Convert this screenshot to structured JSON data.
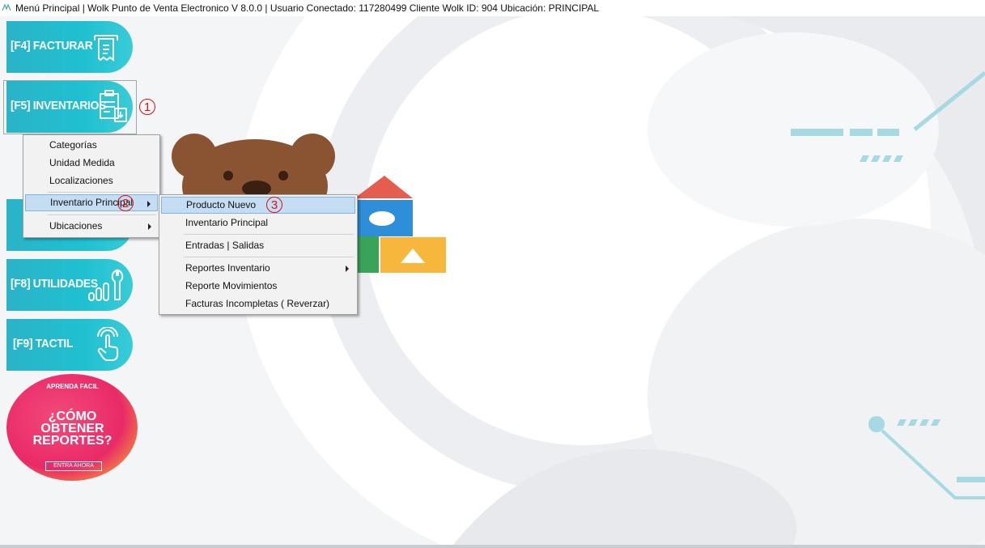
{
  "window": {
    "title": "Menú Principal | Wolk Punto de Venta Electronico V 8.0.0 |  Usuario Conectado: 117280499 Cliente Wolk ID: 904 Ubicación: PRINCIPAL"
  },
  "nav": {
    "facturar": "[F4] FACTURAR",
    "inventarios": "[F5] INVENTARIOS",
    "utilidades": "[F8] UTILIDADES",
    "tactil": "[F9] TACTIL"
  },
  "inventory_menu": {
    "items": [
      "Categorías",
      "Unidad Medida",
      "Localizaciones",
      "Inventario Principal",
      "Ubicaciones"
    ]
  },
  "submenu": {
    "items": [
      "Producto Nuevo",
      "Inventario Principal",
      "Entradas | Salidas",
      "Reportes Inventario",
      "Reporte Movimientos",
      "Facturas Incompletas ( Reverzar)"
    ]
  },
  "annotations": {
    "step1": "1",
    "step2": "2",
    "step3": "3"
  },
  "promo": {
    "kicker": "APRENDA FACIL",
    "line1": "¿CÓMO",
    "line2": "OBTENER",
    "line3": "REPORTES?",
    "cta": "ENTRA AHORA"
  },
  "colors": {
    "accent": "#1fc0d0",
    "highlight": "#c5ddf3",
    "annotation": "#dd1111",
    "promo": "#f0306e"
  }
}
